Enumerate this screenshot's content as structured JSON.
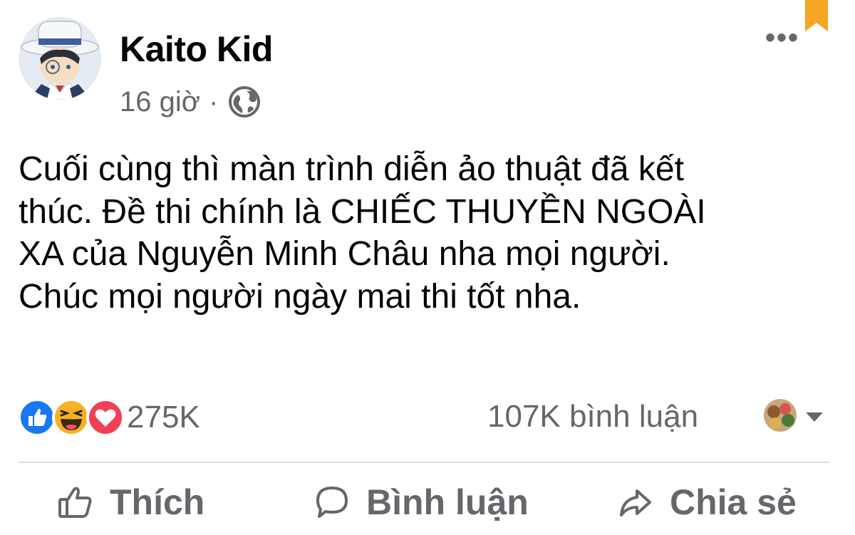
{
  "post": {
    "author": "Kaito Kid",
    "time": "16 giờ",
    "separator": "·",
    "audience_icon": "globe-icon",
    "more_label": "•••",
    "text_lines": [
      "Cuối cùng thì màn trình diễn ảo thuật đã kết",
      "thúc. Đề thi chính là CHIẾC THUYỀN NGOÀI",
      "XA của Nguyễn Minh Châu nha mọi người.",
      "Chúc mọi người ngày mai thi tốt nha."
    ]
  },
  "stats": {
    "reaction_icons": [
      "like-reaction-icon",
      "haha-reaction-icon",
      "love-reaction-icon"
    ],
    "reaction_count": "275K",
    "comment_count": "107K bình luận"
  },
  "actions": {
    "like": "Thích",
    "comment": "Bình luận",
    "share": "Chia sẻ"
  },
  "colors": {
    "text_primary": "#050505",
    "text_secondary": "#65676b",
    "like_blue": "#1877f2",
    "love_red": "#f33e58",
    "haha_yellow": "#f7b125",
    "bookmark_orange": "#f5a623",
    "divider": "#dadde1"
  }
}
